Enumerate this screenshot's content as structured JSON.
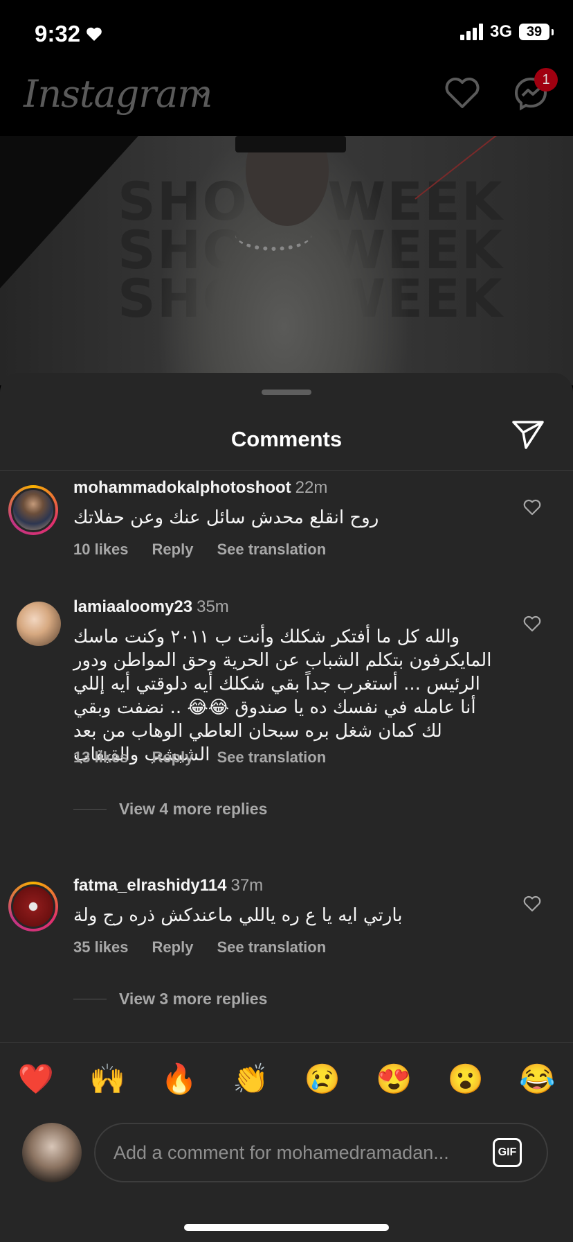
{
  "status_bar": {
    "time": "9:32",
    "network": "3G",
    "battery": "39"
  },
  "header": {
    "logo": "Instagram",
    "badge_count": "1"
  },
  "sheet": {
    "title": "Comments"
  },
  "comments": [
    {
      "username": "mohammadokalphotoshoot",
      "time": "22m",
      "text": "روح انقلع محدش سائل عنك وعن حفلاتك",
      "likes": "10 likes",
      "reply": "Reply",
      "translate": "See translation"
    },
    {
      "username": "lamiaaloomy23",
      "time": "35m",
      "text": "والله كل ما أفتكر شكلك وأنت ب ٢٠١١ وكنت ماسك المايكرفون بتكلم الشباب  عن الحرية وحق المواطن ودور الرئيس ... أستغرب جداً بقي شكلك أيه دلوقتي  أيه إللي أنا عامله في نفسك ده يا صندوق 😂😂 .. نضفت وبقي لك كمان شغل بره سبحان العاطي الوهاب من بعد الشبشب والقبقاب",
      "likes": "13 likes",
      "reply": "Reply",
      "translate": "See translation",
      "view_replies": "View 4 more replies"
    },
    {
      "username": "fatma_elrashidy114",
      "time": "37m",
      "text": "بارتي ايه يا ع ره ياللي ماعندكش ذره رج ولة",
      "likes": "35 likes",
      "reply": "Reply",
      "translate": "See translation",
      "view_replies": "View 3 more replies"
    }
  ],
  "emojis": [
    "❤️",
    "🙌",
    "🔥",
    "👏",
    "😢",
    "😍",
    "😮",
    "😂"
  ],
  "input": {
    "placeholder": "Add a comment for mohamedramadan...",
    "gif": "GIF"
  },
  "colors": {
    "sheet": "#262626",
    "muted": "#a8a8a8",
    "badge": "#a00010"
  }
}
